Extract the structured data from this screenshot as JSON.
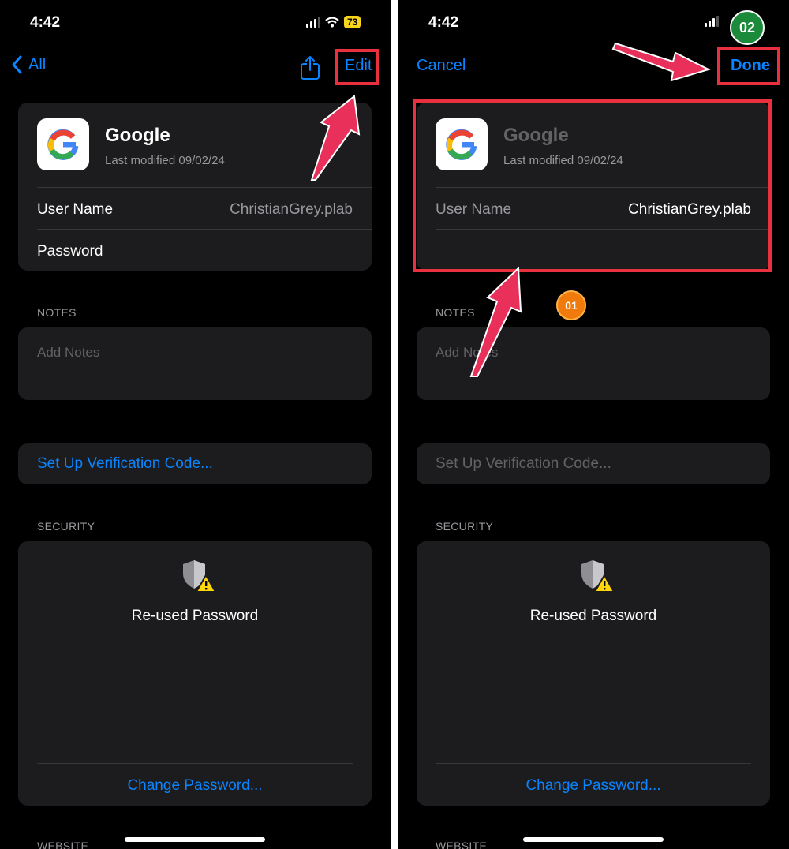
{
  "status": {
    "time": "4:42",
    "battery": "73"
  },
  "left": {
    "nav": {
      "back_label": "All",
      "edit_label": "Edit"
    },
    "entry": {
      "name": "Google",
      "modified": "Last modified 09/02/24"
    },
    "rows": {
      "username_label": "User Name",
      "username_value": "ChristianGrey.plab",
      "password_label": "Password"
    },
    "notes": {
      "header": "NOTES",
      "placeholder": "Add Notes"
    },
    "verification": {
      "label": "Set Up Verification Code..."
    },
    "security": {
      "header": "SECURITY",
      "warning": "Re-used Password",
      "change_password": "Change Password..."
    },
    "website_header": "WEBSITE"
  },
  "right": {
    "nav": {
      "cancel_label": "Cancel",
      "done_label": "Done"
    },
    "entry": {
      "name": "Google",
      "modified": "Last modified 09/02/24"
    },
    "rows": {
      "username_label": "User Name",
      "username_value": "ChristianGrey.plab"
    },
    "notes": {
      "header": "NOTES",
      "placeholder": "Add Notes"
    },
    "verification": {
      "label": "Set Up Verification Code..."
    },
    "security": {
      "header": "SECURITY",
      "warning": "Re-used Password",
      "change_password": "Change Password..."
    },
    "website_header": "WEBSITE"
  },
  "annotations": {
    "step1": "01",
    "step2": "02"
  },
  "colors": {
    "accent": "#0a84ff",
    "highlight": "#e8303f",
    "arrow": "#e8305a",
    "step1": "#f07b0c",
    "step2": "#1b8a3a"
  },
  "icons": [
    "chevron-left-icon",
    "share-icon",
    "google-logo",
    "shield-warning-icon",
    "arrow-annotation"
  ]
}
